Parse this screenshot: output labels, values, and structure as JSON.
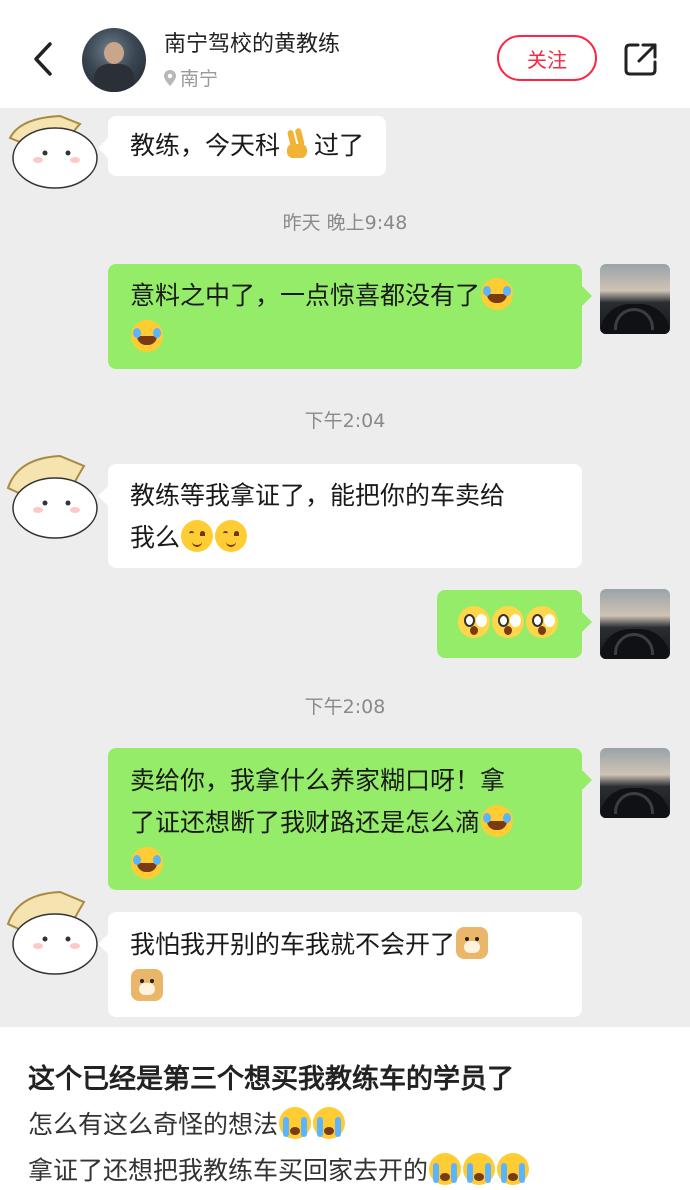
{
  "header": {
    "author_name": "南宁驾校的黄教练",
    "location": "南宁",
    "follow_label": "关注"
  },
  "chat": {
    "messages": [
      {
        "side": "in",
        "text": "教练，今天科",
        "emoji_after": "victory",
        "text2": "过了"
      },
      {
        "timestamp": "昨天 晚上9:48"
      },
      {
        "side": "out",
        "line1": "意料之中了，一点惊喜都没有了",
        "emoji1": "laugh",
        "emoji2": "laugh"
      },
      {
        "timestamp": "下午2:04"
      },
      {
        "side": "in",
        "line1": "教练等我拿证了，能把你的车卖给",
        "line2": "我么",
        "emojis": [
          "blush",
          "blush"
        ]
      },
      {
        "side": "out",
        "emojis": [
          "shock",
          "shock",
          "shock"
        ]
      },
      {
        "timestamp": "下午2:08"
      },
      {
        "side": "out",
        "line1": "卖给你，我拿什么养家糊口呀！拿",
        "line2": "了证还想断了我财路还是怎么滴",
        "emojis": [
          "laugh",
          "laugh"
        ]
      },
      {
        "side": "in",
        "line1": "我怕我开别的车我就不会开了",
        "emojis": [
          "doge",
          "doge"
        ]
      }
    ]
  },
  "post": {
    "title": "这个已经是第三个想买我教练车的学员了",
    "line1": "怎么有这么奇怪的想法",
    "line2": "拿证了还想把我教练车买回家去开的"
  },
  "colors": {
    "accent": "#ff2442",
    "chat_background": "#ededed",
    "outgoing_bubble": "#95ec69",
    "incoming_bubble": "#ffffff"
  }
}
